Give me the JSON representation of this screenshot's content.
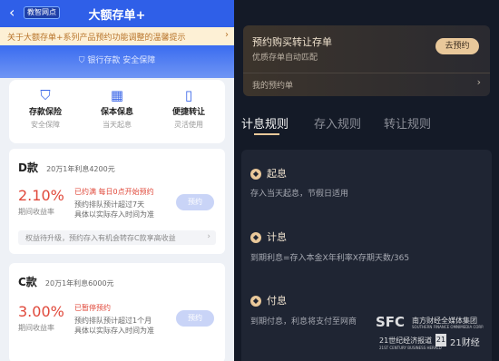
{
  "left": {
    "header": {
      "back_icon": "chevron-left-icon",
      "badge": "教智网点",
      "title": "大额存单+"
    },
    "notice": {
      "text": "关于大额存单+系列产品预约功能调整的温馨提示",
      "chevron": "›"
    },
    "security": {
      "icon": "shield-icon",
      "text": "银行存款 安全保障"
    },
    "features": [
      {
        "icon": "shield-icon",
        "title": "存款保险",
        "sub": "安全保障"
      },
      {
        "icon": "calendar-icon",
        "title": "保本保息",
        "sub": "当天起息"
      },
      {
        "icon": "phone-icon",
        "title": "便捷转让",
        "sub": "灵活使用"
      }
    ],
    "cards": [
      {
        "name": "D款",
        "subtitle": "20万1年利息4200元",
        "rate": "2.10%",
        "rate_label": "期间收益率",
        "status": "已约满 每日0点开始预约",
        "detail1": "预约排队预计超过7天",
        "detail2": "具体以实际存入时间为准",
        "button": "预约",
        "promo": "权益待升级，预约存入有机会转存C款享高收益",
        "promo_chev": "›"
      },
      {
        "name": "C款",
        "subtitle": "20万1年利息6000元",
        "rate": "3.00%",
        "rate_label": "期间收益率",
        "status": "已暂停预约",
        "detail1": "预约排队预计超过1个月",
        "detail2": "具体以实际存入时间为准",
        "button": "预约"
      }
    ]
  },
  "right": {
    "preorder": {
      "title": "预约购买转让存单",
      "subtitle": "优质存单自动匹配",
      "button": "去预约",
      "my_orders": "我的预约单",
      "chevron": "›"
    },
    "tabs": [
      "计息规则",
      "存入规则",
      "转让规则"
    ],
    "rules": [
      {
        "icon": "diamond-icon",
        "title": "起息",
        "text": "存入当天起息，节假日适用"
      },
      {
        "icon": "diamond-icon",
        "title": "计息",
        "text": "到期利息=存入本金X年利率X存期天数/365"
      },
      {
        "icon": "diamond-icon",
        "title": "付息",
        "text": "到期付息，利息将支付至网商"
      }
    ]
  },
  "watermark": {
    "sfc": "SFC",
    "group": "南方财经全媒体集团",
    "group_en": "SOUTHERN FINANCE OMNIMEDIA CORP.",
    "herald": "21世纪经济报道",
    "herald_en": "21ST CENTURY BUSINESS HERALD",
    "logo21": "21",
    "caijing": "21财经"
  }
}
